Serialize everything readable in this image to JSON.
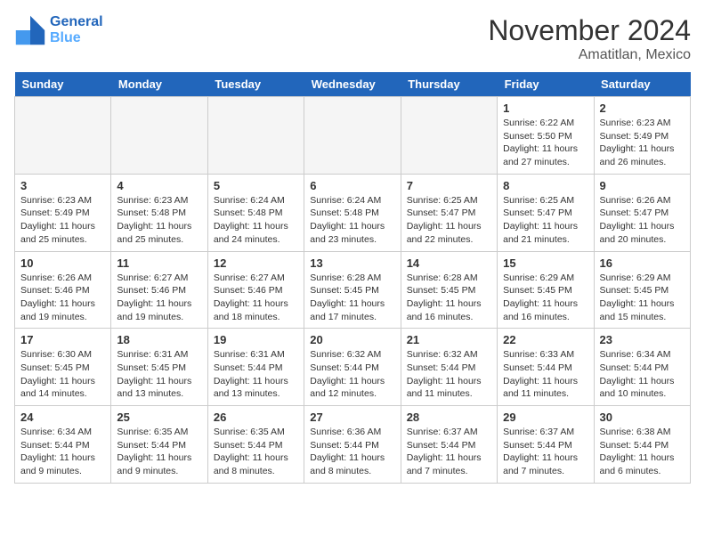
{
  "header": {
    "logo_line1": "General",
    "logo_line2": "Blue",
    "month": "November 2024",
    "location": "Amatitlan, Mexico"
  },
  "weekdays": [
    "Sunday",
    "Monday",
    "Tuesday",
    "Wednesday",
    "Thursday",
    "Friday",
    "Saturday"
  ],
  "weeks": [
    [
      {
        "day": "",
        "info": ""
      },
      {
        "day": "",
        "info": ""
      },
      {
        "day": "",
        "info": ""
      },
      {
        "day": "",
        "info": ""
      },
      {
        "day": "",
        "info": ""
      },
      {
        "day": "1",
        "info": "Sunrise: 6:22 AM\nSunset: 5:50 PM\nDaylight: 11 hours and 27 minutes."
      },
      {
        "day": "2",
        "info": "Sunrise: 6:23 AM\nSunset: 5:49 PM\nDaylight: 11 hours and 26 minutes."
      }
    ],
    [
      {
        "day": "3",
        "info": "Sunrise: 6:23 AM\nSunset: 5:49 PM\nDaylight: 11 hours and 25 minutes."
      },
      {
        "day": "4",
        "info": "Sunrise: 6:23 AM\nSunset: 5:48 PM\nDaylight: 11 hours and 25 minutes."
      },
      {
        "day": "5",
        "info": "Sunrise: 6:24 AM\nSunset: 5:48 PM\nDaylight: 11 hours and 24 minutes."
      },
      {
        "day": "6",
        "info": "Sunrise: 6:24 AM\nSunset: 5:48 PM\nDaylight: 11 hours and 23 minutes."
      },
      {
        "day": "7",
        "info": "Sunrise: 6:25 AM\nSunset: 5:47 PM\nDaylight: 11 hours and 22 minutes."
      },
      {
        "day": "8",
        "info": "Sunrise: 6:25 AM\nSunset: 5:47 PM\nDaylight: 11 hours and 21 minutes."
      },
      {
        "day": "9",
        "info": "Sunrise: 6:26 AM\nSunset: 5:47 PM\nDaylight: 11 hours and 20 minutes."
      }
    ],
    [
      {
        "day": "10",
        "info": "Sunrise: 6:26 AM\nSunset: 5:46 PM\nDaylight: 11 hours and 19 minutes."
      },
      {
        "day": "11",
        "info": "Sunrise: 6:27 AM\nSunset: 5:46 PM\nDaylight: 11 hours and 19 minutes."
      },
      {
        "day": "12",
        "info": "Sunrise: 6:27 AM\nSunset: 5:46 PM\nDaylight: 11 hours and 18 minutes."
      },
      {
        "day": "13",
        "info": "Sunrise: 6:28 AM\nSunset: 5:45 PM\nDaylight: 11 hours and 17 minutes."
      },
      {
        "day": "14",
        "info": "Sunrise: 6:28 AM\nSunset: 5:45 PM\nDaylight: 11 hours and 16 minutes."
      },
      {
        "day": "15",
        "info": "Sunrise: 6:29 AM\nSunset: 5:45 PM\nDaylight: 11 hours and 16 minutes."
      },
      {
        "day": "16",
        "info": "Sunrise: 6:29 AM\nSunset: 5:45 PM\nDaylight: 11 hours and 15 minutes."
      }
    ],
    [
      {
        "day": "17",
        "info": "Sunrise: 6:30 AM\nSunset: 5:45 PM\nDaylight: 11 hours and 14 minutes."
      },
      {
        "day": "18",
        "info": "Sunrise: 6:31 AM\nSunset: 5:45 PM\nDaylight: 11 hours and 13 minutes."
      },
      {
        "day": "19",
        "info": "Sunrise: 6:31 AM\nSunset: 5:44 PM\nDaylight: 11 hours and 13 minutes."
      },
      {
        "day": "20",
        "info": "Sunrise: 6:32 AM\nSunset: 5:44 PM\nDaylight: 11 hours and 12 minutes."
      },
      {
        "day": "21",
        "info": "Sunrise: 6:32 AM\nSunset: 5:44 PM\nDaylight: 11 hours and 11 minutes."
      },
      {
        "day": "22",
        "info": "Sunrise: 6:33 AM\nSunset: 5:44 PM\nDaylight: 11 hours and 11 minutes."
      },
      {
        "day": "23",
        "info": "Sunrise: 6:34 AM\nSunset: 5:44 PM\nDaylight: 11 hours and 10 minutes."
      }
    ],
    [
      {
        "day": "24",
        "info": "Sunrise: 6:34 AM\nSunset: 5:44 PM\nDaylight: 11 hours and 9 minutes."
      },
      {
        "day": "25",
        "info": "Sunrise: 6:35 AM\nSunset: 5:44 PM\nDaylight: 11 hours and 9 minutes."
      },
      {
        "day": "26",
        "info": "Sunrise: 6:35 AM\nSunset: 5:44 PM\nDaylight: 11 hours and 8 minutes."
      },
      {
        "day": "27",
        "info": "Sunrise: 6:36 AM\nSunset: 5:44 PM\nDaylight: 11 hours and 8 minutes."
      },
      {
        "day": "28",
        "info": "Sunrise: 6:37 AM\nSunset: 5:44 PM\nDaylight: 11 hours and 7 minutes."
      },
      {
        "day": "29",
        "info": "Sunrise: 6:37 AM\nSunset: 5:44 PM\nDaylight: 11 hours and 7 minutes."
      },
      {
        "day": "30",
        "info": "Sunrise: 6:38 AM\nSunset: 5:44 PM\nDaylight: 11 hours and 6 minutes."
      }
    ]
  ]
}
